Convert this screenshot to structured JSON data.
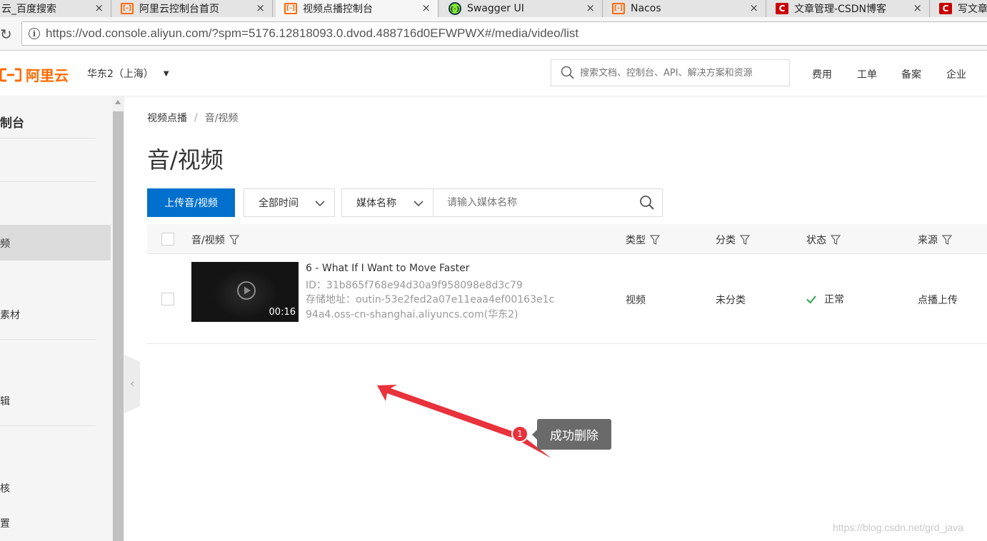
{
  "browser": {
    "tabs": [
      {
        "title": "云_百度搜索",
        "favicon": "none",
        "active": false
      },
      {
        "title": "阿里云控制台首页",
        "favicon": "aliyun-icon",
        "active": false
      },
      {
        "title": "视频点播控制台",
        "favicon": "aliyun-icon",
        "active": true
      },
      {
        "title": "Swagger UI",
        "favicon": "swagger-icon",
        "active": false
      },
      {
        "title": "Nacos",
        "favicon": "aliyun-icon",
        "active": false
      },
      {
        "title": "文章管理-CSDN博客",
        "favicon": "csdn-icon",
        "active": false
      },
      {
        "title": "写文章",
        "favicon": "csdn-icon",
        "active": false
      }
    ],
    "close_glyph": "×",
    "url": "https://vod.console.aliyun.com/?spm=5176.12818093.0.dvod.488716d0EFWPWX#/media/video/list"
  },
  "topnav": {
    "logo_text": "阿里云",
    "region": "华东2（上海）",
    "search_placeholder": "搜索文档、控制台、API、解决方案和资源",
    "links": [
      "费用",
      "工单",
      "备案",
      "企业"
    ]
  },
  "sidebar": {
    "title": "制台",
    "items": [
      "频",
      "素材",
      "辑",
      "核",
      "置"
    ],
    "active_index": 0
  },
  "main": {
    "breadcrumb": {
      "parent": "视频点播",
      "separator": "/",
      "current": "音/视频"
    },
    "page_title": "音/视频",
    "toolbar": {
      "upload_label": "上传音/视频",
      "time_filter": "全部时间",
      "search_field": "媒体名称",
      "search_placeholder": "请输入媒体名称"
    },
    "table": {
      "columns": [
        "音/视频",
        "类型",
        "分类",
        "状态",
        "来源"
      ],
      "rows": [
        {
          "name": "6 - What If I Want to Move Faster",
          "id": "ID：31b865f768e94d30a9f958098e8d3c79",
          "storage": "存储地址：outin-53e2fed2a07e11eaa4ef00163e1c94a4.oss-cn-shanghai.aliyuncs.com(华东2)",
          "duration": "00:16",
          "type": "视频",
          "category": "未分类",
          "status": "正常",
          "source": "点播上传"
        }
      ]
    }
  },
  "annotation": {
    "badge_number": "1",
    "tooltip_text": "成功删除"
  },
  "watermark": "https://blog.csdn.net/grd_java",
  "colors": {
    "primary": "#0070cc",
    "brand_orange": "#ff6a00",
    "status_ok": "#2aa44f",
    "annotation_red": "#e8323c"
  }
}
